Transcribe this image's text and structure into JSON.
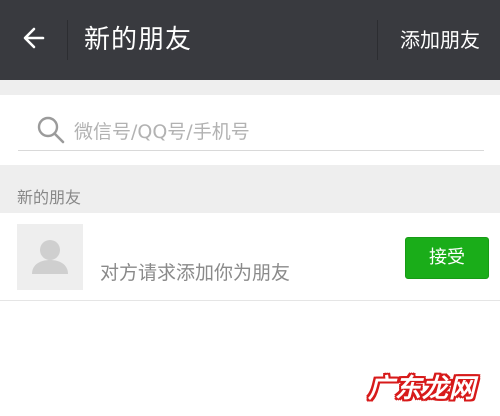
{
  "header": {
    "title": "新的朋友",
    "action_label": "添加朋友",
    "back_icon": "arrow-left-icon",
    "background_color": "#393a3f"
  },
  "search": {
    "placeholder": "微信号/QQ号/手机号",
    "icon": "search-icon"
  },
  "section": {
    "label": "新的朋友"
  },
  "friend_requests": [
    {
      "avatar_icon": "default-avatar-icon",
      "message": "对方请求添加你为朋友",
      "accept_label": "接受",
      "accept_color": "#1aad19"
    }
  ],
  "watermark": {
    "text": "广东龙网",
    "color": "#d71a1a"
  }
}
